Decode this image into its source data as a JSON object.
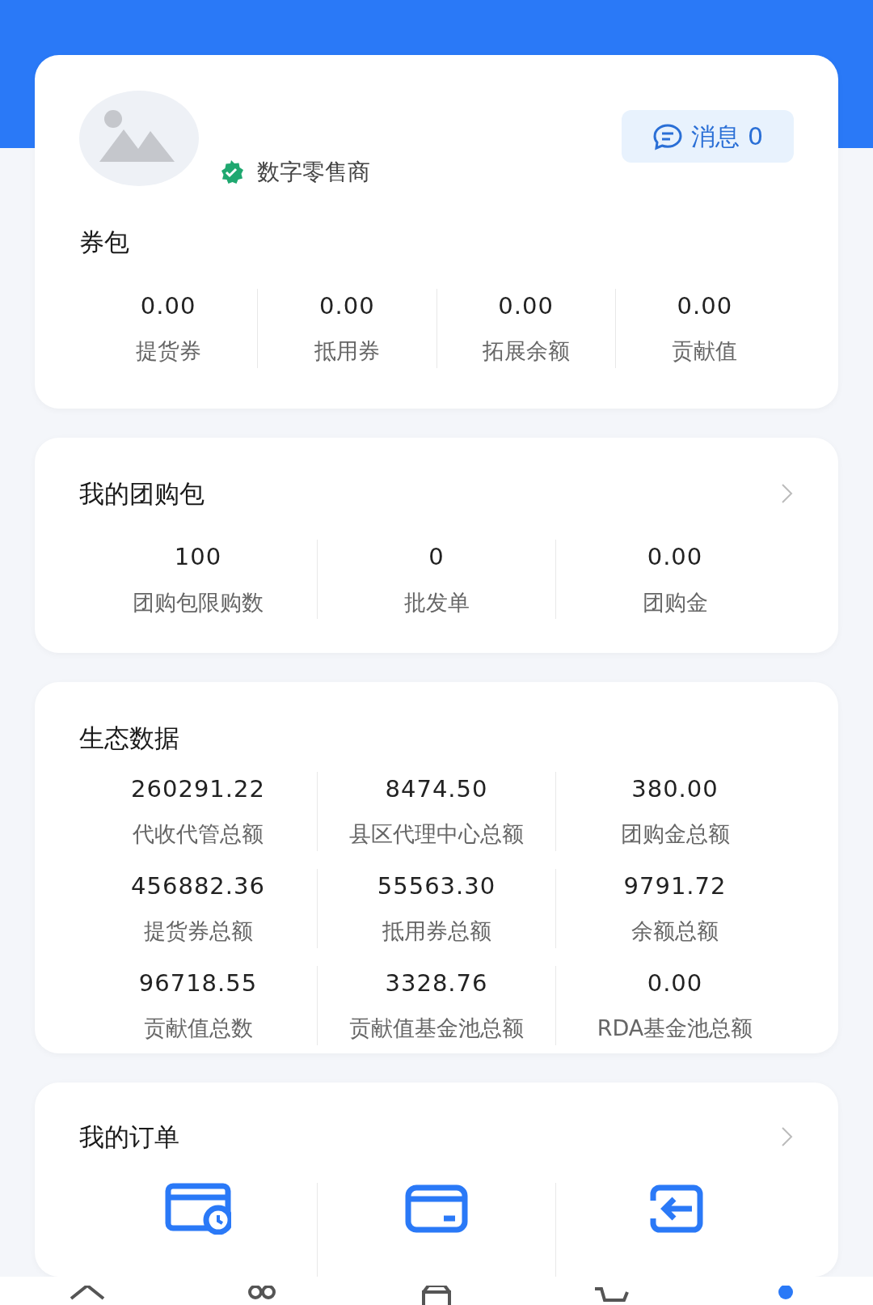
{
  "profile": {
    "role": "数字零售商",
    "verified": true,
    "messages_button": {
      "label": "消息",
      "count": "0"
    }
  },
  "wallet": {
    "title": "券包",
    "stats": [
      {
        "value": "0.00",
        "label": "提货券"
      },
      {
        "value": "0.00",
        "label": "抵用券"
      },
      {
        "value": "0.00",
        "label": "拓展余额"
      },
      {
        "value": "0.00",
        "label": "贡献值"
      }
    ]
  },
  "group_buy": {
    "title": "我的团购包",
    "stats": [
      {
        "value": "100",
        "label": "团购包限购数"
      },
      {
        "value": "0",
        "label": "批发单"
      },
      {
        "value": "0.00",
        "label": "团购金"
      }
    ]
  },
  "ecosystem": {
    "title": "生态数据",
    "stats": [
      {
        "value": "260291.22",
        "label": "代收代管总额"
      },
      {
        "value": "8474.50",
        "label": "县区代理中心总额"
      },
      {
        "value": "380.00",
        "label": "团购金总额"
      },
      {
        "value": "456882.36",
        "label": "提货券总额"
      },
      {
        "value": "55563.30",
        "label": "抵用券总额"
      },
      {
        "value": "9791.72",
        "label": "余额总额"
      },
      {
        "value": "96718.55",
        "label": "贡献值总数"
      },
      {
        "value": "3328.76",
        "label": "贡献值基金池总额"
      },
      {
        "value": "0.00",
        "label": "RDA基金池总额"
      }
    ]
  },
  "orders": {
    "title": "我的订单",
    "items": [
      {
        "kind": "pending-payment"
      },
      {
        "kind": "pending-receipt"
      },
      {
        "kind": "return"
      }
    ]
  },
  "bottom_nav": [
    {
      "kind": "home",
      "selected": false
    },
    {
      "kind": "people",
      "selected": false
    },
    {
      "kind": "box",
      "selected": false
    },
    {
      "kind": "cart",
      "selected": false
    },
    {
      "kind": "profile",
      "selected": true
    }
  ]
}
